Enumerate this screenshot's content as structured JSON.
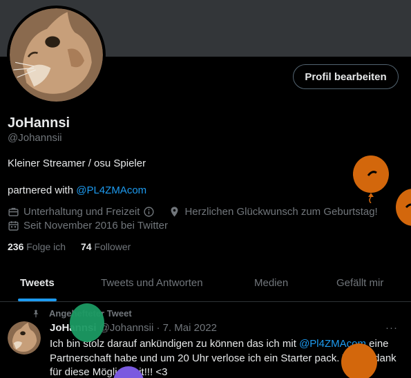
{
  "profile": {
    "display_name": "JoHannsi",
    "handle": "@Johannsii",
    "edit_button": "Profil bearbeiten",
    "bio_line1": "Kleiner Streamer / osu Spieler",
    "bio_line2_prefix": "partnered with ",
    "bio_line2_link": "@PL4ZMAcom",
    "category": "Unterhaltung und Freizeit",
    "location": "Herzlichen Glückwunsch zum Geburtstag!",
    "joined": "Seit November 2016 bei Twitter",
    "following_count": "236",
    "following_label": "Folge ich",
    "followers_count": "74",
    "followers_label": "Follower"
  },
  "tabs": [
    {
      "label": "Tweets"
    },
    {
      "label": "Tweets und Antworten"
    },
    {
      "label": "Medien"
    },
    {
      "label": "Gefällt mir"
    }
  ],
  "tweet": {
    "pinned_label": "Angehefteter Tweet",
    "author": "JoHannsi",
    "handle_date": "@Johannsii · 7. Mai 2022",
    "more": "···",
    "text_part1": "Ich bin stolz darauf ankündigen zu können das ich mit ",
    "mention": "@Pl4ZMAcom",
    "text_part2": " eine Partnerschaft habe und um 20 Uhr verlose ich ein Starter pack. Vielen dank für diese Möglichkeit!!! <3"
  },
  "icons": {
    "category": "briefcase-icon",
    "info": "info-icon",
    "location": "location-pin-icon",
    "calendar": "calendar-icon",
    "pin": "pin-icon"
  },
  "colors": {
    "accent": "#1d9bf0",
    "balloon_orange": "#d3670c",
    "balloon_green": "#1b9a63",
    "balloon_purple": "#7a5ae0"
  }
}
